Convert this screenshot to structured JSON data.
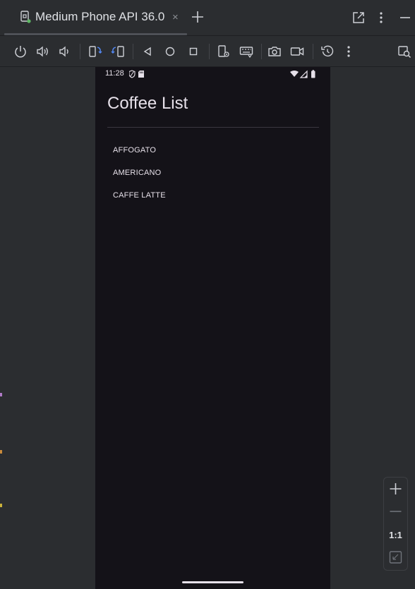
{
  "tab": {
    "title": "Medium Phone API 36.0",
    "close_glyph": "×",
    "icon": "device-icon"
  },
  "toolbar": {
    "buttons": [
      "power-icon",
      "volume-up-icon",
      "volume-down-icon",
      "rotate-left-icon",
      "rotate-right-icon",
      "back-icon",
      "home-icon",
      "overview-icon",
      "device-settings-icon",
      "keyboard-icon",
      "camera-icon",
      "screen-record-icon",
      "snapshot-icon",
      "more-icon",
      "extended-controls-icon"
    ]
  },
  "device": {
    "status_time": "11:28",
    "app_title": "Coffee List",
    "coffees": [
      "AFFOGATO",
      "AMERICANO",
      "CAFFE LATTE"
    ]
  },
  "zoom": {
    "ratio_label": "1:1"
  },
  "colors": {
    "ide_background": "#2b2d30",
    "screen_background": "#141218",
    "text_primary": "#dfe1e5",
    "screen_text": "#e6e0e9",
    "accent_blue": "#548af7",
    "online_dot": "#5fb865"
  }
}
